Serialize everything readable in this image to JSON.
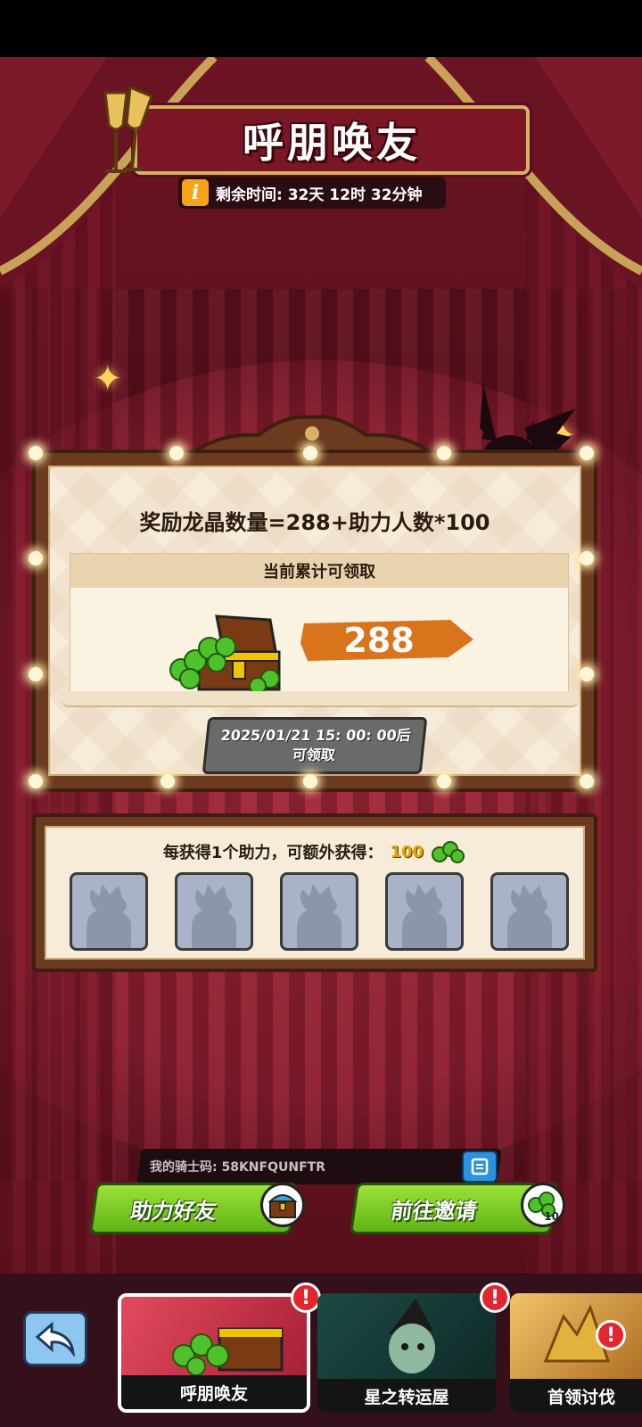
{
  "header": {
    "title": "呼朋唤友",
    "timer_label": "剩余时间: 32天 12时 32分钟",
    "info_icon": "i"
  },
  "board": {
    "formula": "奖励龙晶数量=288+助力人数*100",
    "accumulated_label": "当前累计可领取",
    "amount": "288",
    "claim_time": "2025/01/21 15: 00: 00后",
    "claim_suffix": "可领取"
  },
  "assist": {
    "title": "每获得1个助力，可额外获得：",
    "bonus": "100",
    "slots": [
      "empty",
      "empty",
      "empty",
      "empty",
      "empty"
    ]
  },
  "code": {
    "label": "我的骑士码: 58KNFQUNFTR",
    "copy_icon": "copy-icon"
  },
  "actions": {
    "help_friend": "助力好友",
    "go_invite": "前往邀请",
    "invite_badge": "10"
  },
  "tabs": [
    {
      "label": "呼朋唤友",
      "alert": "!"
    },
    {
      "label": "星之转运屋",
      "alert": "!"
    },
    {
      "label": "首领讨伐",
      "alert": "!"
    }
  ],
  "colors": {
    "accent_green": "#6cc11f",
    "amount_brush": "#d9731c",
    "background": "#7a1828"
  }
}
